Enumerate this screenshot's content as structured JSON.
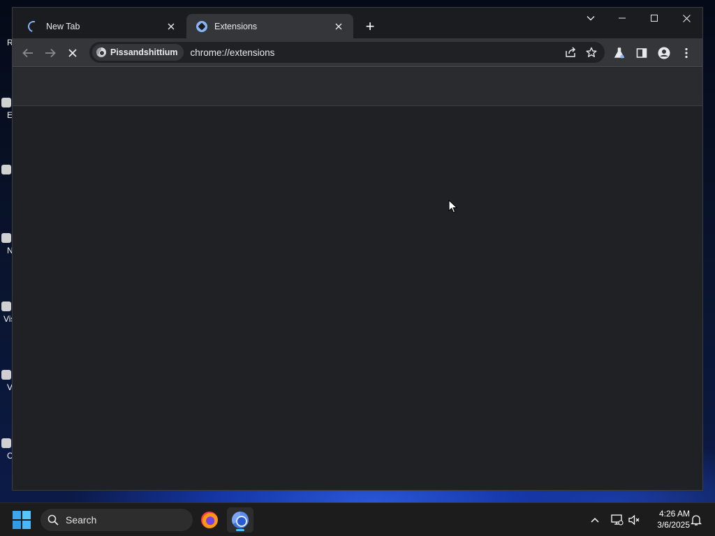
{
  "desktop": {
    "icons": [
      {
        "label": "R",
        "color": "#c0392b"
      },
      {
        "label": "E",
        "color": "#d0d0d0"
      },
      {
        "label": "",
        "color": "#d0d0d0"
      },
      {
        "label": "N",
        "color": "#d0d0d0"
      },
      {
        "label": "Vis",
        "color": "#1e88e5"
      },
      {
        "label": "V",
        "color": "#d0d0d0"
      },
      {
        "label": "C",
        "color": "#3a7bd5"
      }
    ]
  },
  "browser": {
    "tabs": [
      {
        "title": "New Tab",
        "state": "loading",
        "icon": "spinner-icon"
      },
      {
        "title": "Extensions",
        "state": "active",
        "icon": "extensions-favicon-icon"
      }
    ],
    "new_tab_label": "+",
    "toolbar": {
      "site_chip_label": "Pissandshittium",
      "url": "chrome://extensions",
      "back_enabled": false,
      "forward_enabled": false,
      "loading": true
    },
    "colors": {
      "frame": "#1b1c1f",
      "toolbar": "#35363a",
      "content": "#202124",
      "accent": "#8ab4f8"
    }
  },
  "taskbar": {
    "search_label": "Search",
    "apps": [
      {
        "name": "firefox-icon"
      },
      {
        "name": "chromium-icon",
        "running": true
      }
    ],
    "clock": {
      "time": "4:26 AM",
      "date": "3/6/2025"
    }
  }
}
